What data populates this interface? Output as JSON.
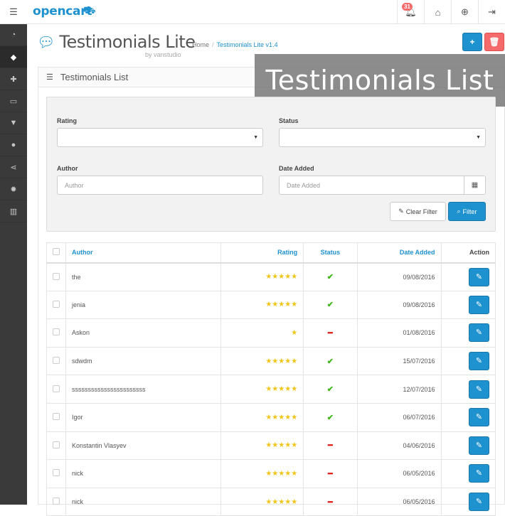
{
  "topbar": {
    "logo": "opencart",
    "logo_cart_icon": "cart-icon",
    "notification_count": "31"
  },
  "sidebar": {
    "items": [
      {
        "icon": "dashboard-icon",
        "glyph": "◔"
      },
      {
        "icon": "tags-icon",
        "glyph": "◆"
      },
      {
        "icon": "puzzle-icon",
        "glyph": "✚"
      },
      {
        "icon": "monitor-icon",
        "glyph": "▭"
      },
      {
        "icon": "shopping-cart-icon",
        "glyph": "▼"
      },
      {
        "icon": "user-icon",
        "glyph": "●"
      },
      {
        "icon": "share-icon",
        "glyph": "⋖"
      },
      {
        "icon": "cog-icon",
        "glyph": "✹"
      },
      {
        "icon": "bar-chart-icon",
        "glyph": "▥"
      }
    ]
  },
  "header": {
    "title": "Testimonials Lite",
    "byline": "by vanstudio",
    "breadcrumb": [
      {
        "label": "Home"
      },
      {
        "label": "Testimonials Lite v1.4"
      }
    ]
  },
  "panel": {
    "title": "Testimonials List"
  },
  "overlay": {
    "text": "Testimonials List"
  },
  "filter": {
    "rating_label": "Rating",
    "status_label": "Status",
    "author_label": "Author",
    "author_placeholder": "Author",
    "date_label": "Date Added",
    "date_placeholder": "Date Added",
    "clear_label": "Clear Filter",
    "filter_label": "Filter"
  },
  "table": {
    "columns": {
      "author": "Author",
      "rating": "Rating",
      "status": "Status",
      "date": "Date Added",
      "action": "Action"
    },
    "rows": [
      {
        "author": "the",
        "rating": 5,
        "status": "enabled",
        "date": "09/08/2016"
      },
      {
        "author": "jenia",
        "rating": 5,
        "status": "enabled",
        "date": "09/08/2016"
      },
      {
        "author": "Askon",
        "rating": 1,
        "status": "disabled",
        "date": "01/08/2016"
      },
      {
        "author": "sdwdm",
        "rating": 5,
        "status": "enabled",
        "date": "15/07/2016"
      },
      {
        "author": "sssssssssssssssssssssss",
        "rating": 5,
        "status": "enabled",
        "date": "12/07/2016"
      },
      {
        "author": "Igor",
        "rating": 5,
        "status": "enabled",
        "date": "06/07/2016"
      },
      {
        "author": "Konstantin Vlasyev",
        "rating": 5,
        "status": "disabled",
        "date": "04/06/2016"
      },
      {
        "author": "nick",
        "rating": 5,
        "status": "disabled",
        "date": "06/05/2016"
      },
      {
        "author": "nick",
        "rating": 5,
        "status": "disabled",
        "date": "06/05/2016"
      }
    ]
  },
  "colors": {
    "primary": "#1e91cf",
    "danger": "#f56b6b",
    "star": "#f0c419",
    "enabled": "#3fb618",
    "disabled": "#e0201b",
    "sidebar": "#3a3a3a"
  }
}
